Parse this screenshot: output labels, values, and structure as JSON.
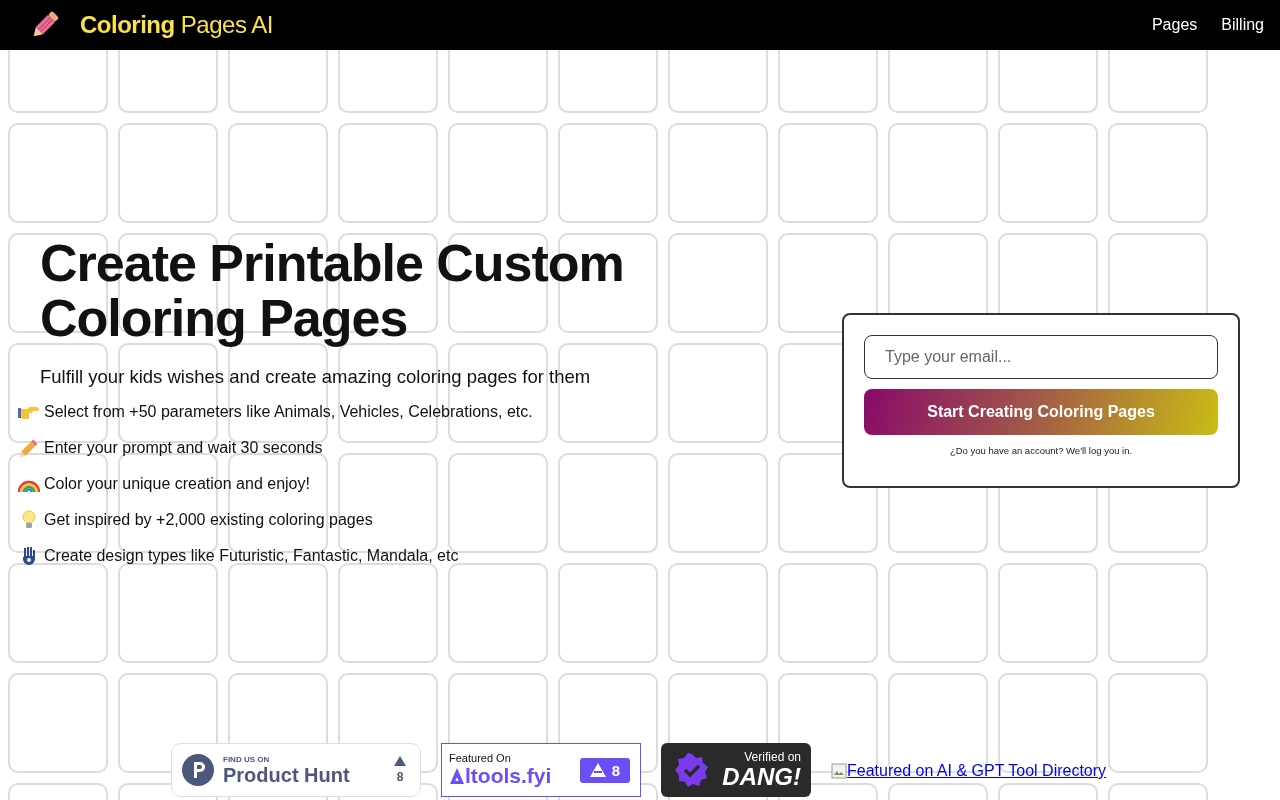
{
  "header": {
    "logo_bold": "Coloring",
    "logo_light": "Pages AI",
    "nav": [
      "Pages",
      "Billing"
    ]
  },
  "hero": {
    "title": "Create Printable Custom Coloring Pages",
    "subtitle": "Fulfill your kids wishes and create amazing coloring pages for them",
    "features": [
      {
        "kind": "hand",
        "text": "Select from +50 parameters like Animals, Vehicles, Celebrations, etc."
      },
      {
        "kind": "pencil",
        "text": "Enter your prompt and wait 30 seconds"
      },
      {
        "kind": "rainbow",
        "text": "Color your unique creation and enjoy!"
      },
      {
        "kind": "bulb",
        "text": "Get inspired by +2,000 existing coloring pages"
      },
      {
        "kind": "hamsa",
        "text": "Create design types like Futuristic, Fantastic, Mandala, etc"
      }
    ]
  },
  "signup": {
    "placeholder": "Type your email...",
    "button": "Start Creating Coloring Pages",
    "note": "¿Do you have an account? We'll log you in."
  },
  "badges": [
    {
      "kind": "producthunt",
      "top": "FIND US ON",
      "name": "Product Hunt",
      "count": "8"
    },
    {
      "kind": "aitools",
      "top": "Featured On",
      "name": "ltools.fyi",
      "count": "8"
    },
    {
      "kind": "dang",
      "top": "Verified on",
      "name": "DANG!"
    },
    {
      "kind": "link",
      "name": "Featured on AI & GPT Tool Directory"
    }
  ]
}
